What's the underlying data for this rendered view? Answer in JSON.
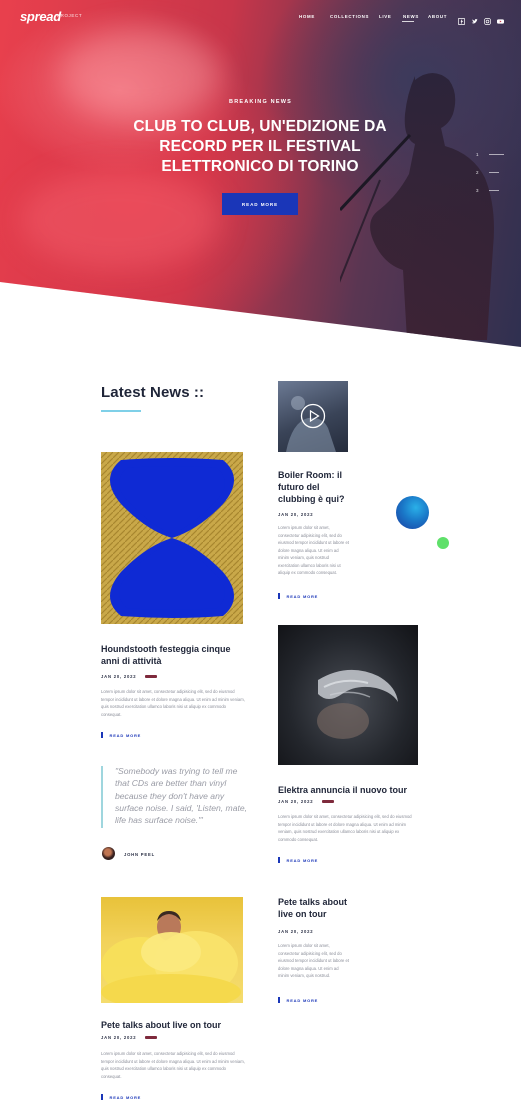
{
  "brand": {
    "logo": "spread",
    "sub": "PROJECT"
  },
  "nav": {
    "items": [
      "HOME",
      "COLLECTIONS",
      "LIVE",
      "NEWS",
      "ABOUT"
    ],
    "active": "NEWS"
  },
  "hero": {
    "kicker": "BREAKING NEWS",
    "headline": "CLUB TO CLUB, UN'EDIZIONE DA RECORD PER IL FESTIVAL ELETTRONICO DI TORINO",
    "button": "READ MORE",
    "slides": [
      "1",
      "2",
      "3"
    ]
  },
  "section": {
    "title": "Latest News ::"
  },
  "posts": {
    "houndstooth": {
      "title": "Houndstooth festeggia cinque anni di attività",
      "date": "JAN 20, 2022",
      "excerpt": "Lorem ipsum dolor sit amet, consectetur adipisicing elit, sed do eiusmod tempor incididunt ut labore et dolore magna aliqua. Ut enim ad minim veniam, quis nostrud exercitation ullamco laboris nisi ut aliquip ex commodo consequat.",
      "readmore": "READ MORE"
    },
    "boiler": {
      "title": "Boiler Room: il futuro del clubbing è qui?",
      "date": "JAN 20, 2022",
      "excerpt": "Lorem ipsum dolor sit amet, consectetur adipisicing elit, sed do eiusmod tempor incididunt ut labore et dolore magna aliqua. Ut enim ad minim veniam, quis nostrud exercitation ullamco laboris nisi ut aliquip ex commodo consequat.",
      "readmore": "READ MORE"
    },
    "elektra": {
      "title": "Elektra annuncia il nuovo tour",
      "date": "JAN 20, 2022",
      "excerpt": "Lorem ipsum dolor sit amet, consectetur adipisicing elit, sed do eiusmod tempor incididunt ut labore et dolore magna aliqua. Ut enim ad minim veniam, quis nostrud exercitation ullamco laboris nisi ut aliquip ex commodo consequat.",
      "readmore": "READ MORE"
    },
    "pete_text": {
      "title": "Pete talks about live on tour",
      "date": "JAN 20, 2022",
      "excerpt": "Lorem ipsum dolor sit amet, consectetur adipisicing elit, sed do eiusmod tempor incididunt ut labore et dolore magna aliqua. Ut enim ad minim veniam, quis nostrud.",
      "readmore": "READ MORE"
    },
    "pete_img": {
      "title": "Pete talks about live on tour",
      "date": "JAN 20, 2022",
      "excerpt": "Lorem ipsum dolor sit amet, consectetur adipisicing elit, sed do eiusmod tempor incididunt ut labore et dolore magna aliqua. Ut enim ad minim veniam, quis nostrud exercitation ullamco laboris nisi ut aliquip ex commodo consequat.",
      "readmore": "READ MORE"
    }
  },
  "quote": {
    "text": "\"Somebody was trying to tell me that CDs are better than vinyl because they don't have any surface noise. I said, 'Listen, mate, life has surface noise.'\"",
    "author": "JOHN PEEL"
  },
  "colors": {
    "accent": "#1a36b8",
    "hero_red": "#e9404d",
    "hero_navy": "#2f3050",
    "tag": "#7e2a3c",
    "quote_bar": "#9fd6de",
    "deco_green": "#5fe06a"
  }
}
